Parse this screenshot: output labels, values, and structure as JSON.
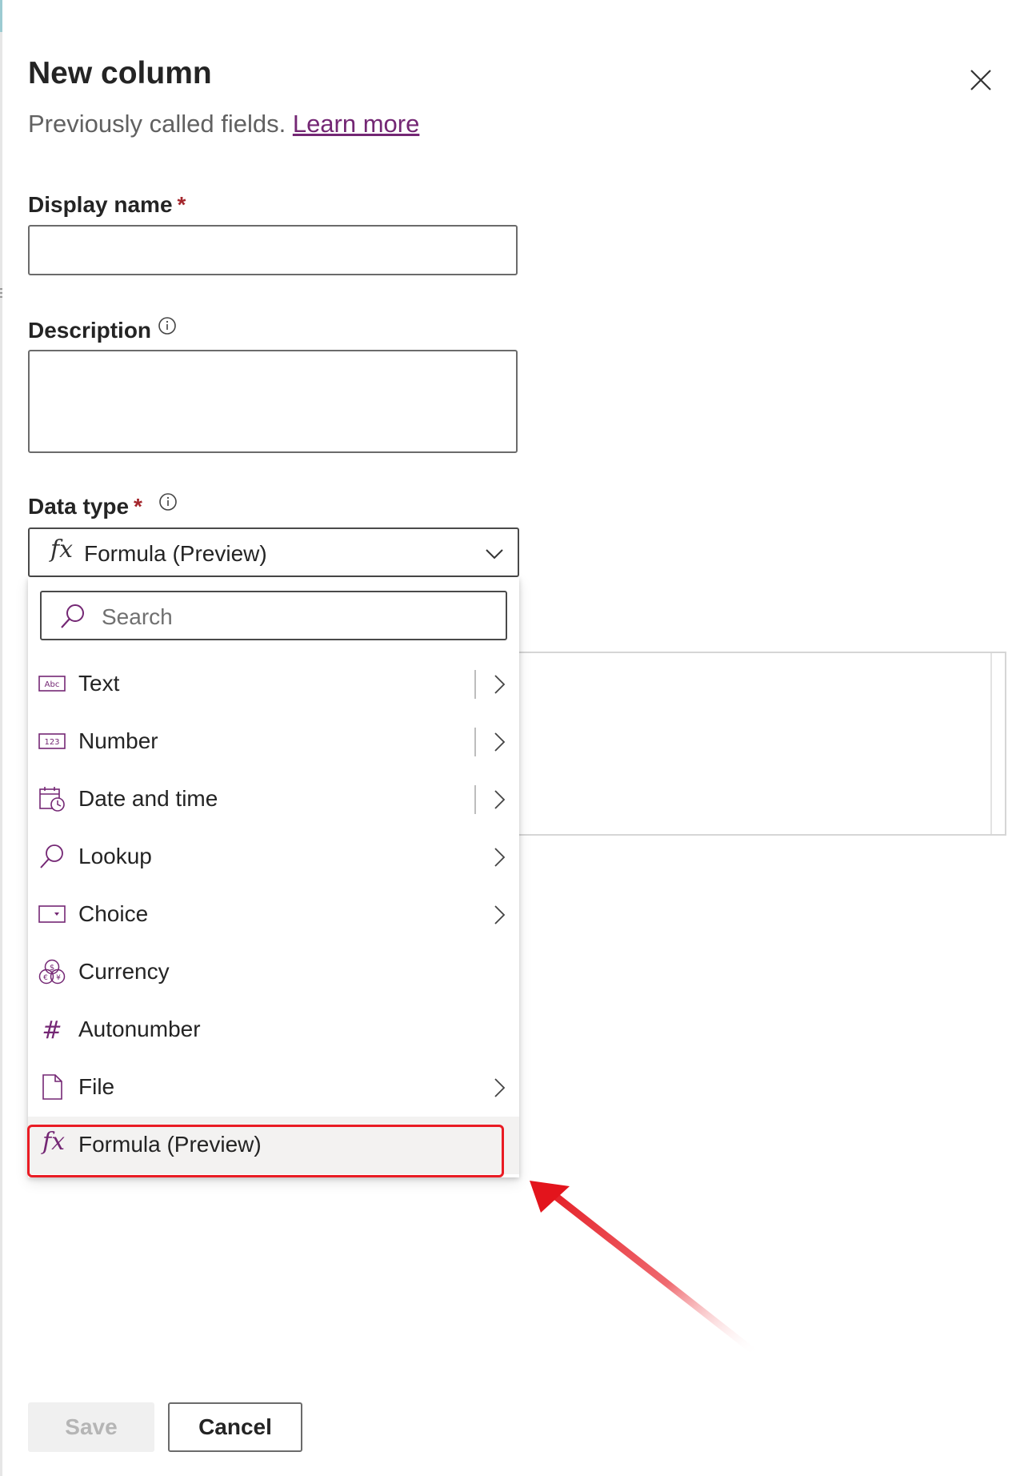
{
  "header": {
    "title": "New column",
    "subtitle": "Previously called fields.",
    "learn_more": "Learn more"
  },
  "fields": {
    "display_name": {
      "label": "Display name",
      "required_mark": "*",
      "value": ""
    },
    "description": {
      "label": "Description",
      "value": ""
    },
    "data_type": {
      "label": "Data type",
      "required_mark": "*",
      "selected": "Formula (Preview)",
      "selected_icon": "fx"
    }
  },
  "menu": {
    "search_placeholder": "Search",
    "items": [
      {
        "label": "Text",
        "icon": "text-abc-icon",
        "has_submenu": true,
        "has_separator": true
      },
      {
        "label": "Number",
        "icon": "number-123-icon",
        "has_submenu": true,
        "has_separator": true
      },
      {
        "label": "Date and time",
        "icon": "calendar-clock-icon",
        "has_submenu": true,
        "has_separator": true
      },
      {
        "label": "Lookup",
        "icon": "search-icon",
        "has_submenu": true,
        "has_separator": false
      },
      {
        "label": "Choice",
        "icon": "choice-dropdown-icon",
        "has_submenu": true,
        "has_separator": false
      },
      {
        "label": "Currency",
        "icon": "currency-icon",
        "has_submenu": false,
        "has_separator": false
      },
      {
        "label": "Autonumber",
        "icon": "hash-icon",
        "has_submenu": false,
        "has_separator": false
      },
      {
        "label": "File",
        "icon": "file-icon",
        "has_submenu": true,
        "has_separator": false
      },
      {
        "label": "Formula (Preview)",
        "icon": "fx",
        "has_submenu": false,
        "has_separator": false,
        "selected": true
      }
    ]
  },
  "footer": {
    "save_label": "Save",
    "cancel_label": "Cancel"
  },
  "colors": {
    "accent": "#742774",
    "required": "#a4262c",
    "annotation": "#ea1c24"
  }
}
